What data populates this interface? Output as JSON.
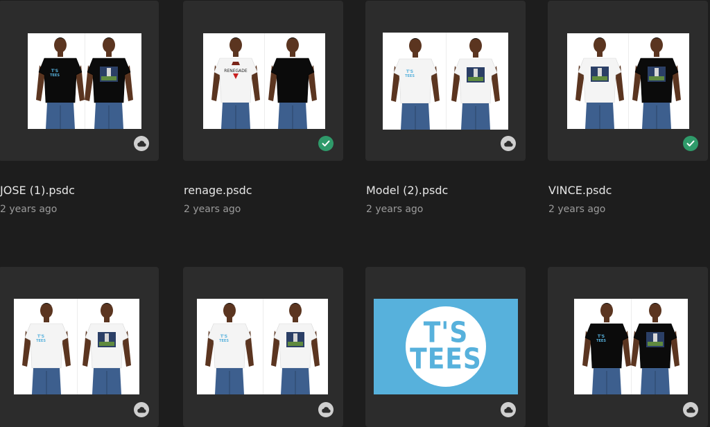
{
  "files": [
    {
      "name": "JOSE (1).psdc",
      "time": "2 years ago",
      "status": "cloud-icon",
      "left_shirt": "#0b0b0b",
      "right_shirt": "#0b0b0b",
      "left_print": "logo",
      "right_print": "photo"
    },
    {
      "name": "renage.psdc",
      "time": "2 years ago",
      "status": "check-icon",
      "left_shirt": "#f4f4f4",
      "right_shirt": "#0b0b0b",
      "left_print": "renegade",
      "right_print": "none"
    },
    {
      "name": "Model (2).psdc",
      "time": "2 years ago",
      "status": "cloud-icon",
      "left_shirt": "#f4f4f4",
      "right_shirt": "#f4f4f4",
      "left_print": "logo",
      "right_print": "photo"
    },
    {
      "name": "VINCE.psdc",
      "time": "2 years ago",
      "status": "check-icon",
      "left_shirt": "#f4f4f4",
      "right_shirt": "#0b0b0b",
      "left_print": "photo",
      "right_print": "photo"
    },
    {
      "name": "",
      "time": "",
      "status": "cloud-icon",
      "left_shirt": "#f4f4f4",
      "right_shirt": "#f4f4f4",
      "left_print": "logo",
      "right_print": "photo"
    },
    {
      "name": "",
      "time": "",
      "status": "cloud-icon",
      "left_shirt": "#f4f4f4",
      "right_shirt": "#f4f4f4",
      "left_print": "logo",
      "right_print": "photo"
    },
    {
      "name": "",
      "time": "",
      "status": "cloud-icon",
      "logo_lines": [
        "T'S",
        "TEES"
      ]
    },
    {
      "name": "",
      "time": "",
      "status": "cloud-icon",
      "left_shirt": "#0b0b0b",
      "right_shirt": "#0b0b0b",
      "left_print": "logo",
      "right_print": "photo"
    }
  ],
  "chest_logo_text": "T'S TEES",
  "print_text": "RENEGADE",
  "colors": {
    "background": "#1d1d1d",
    "card": "#2c2c2c",
    "accent_blue": "#57b1dc",
    "sync_green": "#2f9a6a"
  }
}
